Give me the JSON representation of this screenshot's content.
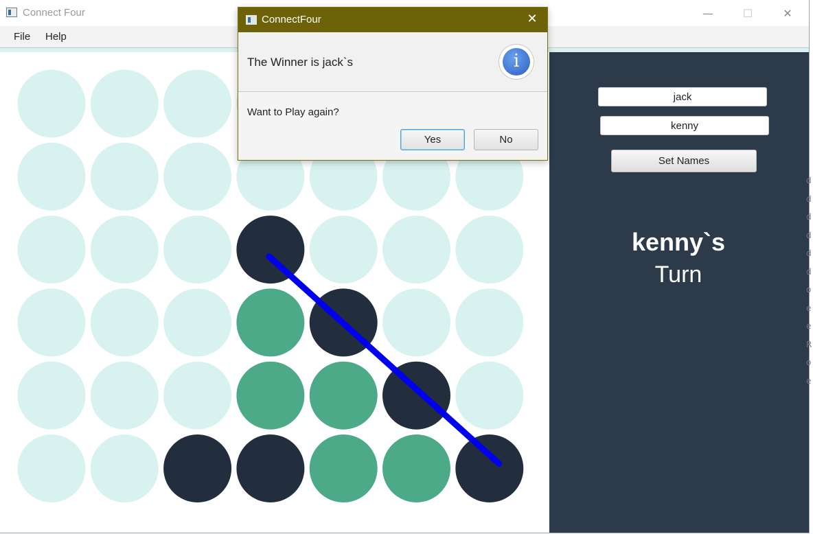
{
  "window": {
    "title": "Connect Four",
    "controls": {
      "minimize": "—",
      "maximize": "☐",
      "close": "✕"
    }
  },
  "menu": {
    "items": [
      "File",
      "Help"
    ]
  },
  "colors": {
    "empty": "#d8f3ef",
    "player_dark": "#222e3d",
    "player_green": "#4caa88",
    "win_line": "#0000ee",
    "sidebar": "#2c3a4a",
    "dialog_title": "#6e6208"
  },
  "board": {
    "columns": 7,
    "rows": 6,
    "cells": [
      [
        "empty",
        "empty",
        "empty",
        "empty",
        "empty",
        "empty",
        "empty"
      ],
      [
        "empty",
        "empty",
        "empty",
        "empty",
        "empty",
        "empty",
        "empty"
      ],
      [
        "empty",
        "empty",
        "empty",
        "dark",
        "empty",
        "empty",
        "empty"
      ],
      [
        "empty",
        "empty",
        "empty",
        "green",
        "dark",
        "empty",
        "empty"
      ],
      [
        "empty",
        "empty",
        "empty",
        "green",
        "green",
        "dark",
        "empty"
      ],
      [
        "empty",
        "empty",
        "dark",
        "dark",
        "green",
        "green",
        "dark"
      ]
    ],
    "win_line": {
      "from": [
        2,
        3
      ],
      "to": [
        5,
        6
      ]
    }
  },
  "sidebar": {
    "player1_name": "jack",
    "player2_name": "kenny",
    "set_names_label": "Set Names",
    "turn_name": "kenny`s",
    "turn_label": "Turn"
  },
  "dialog": {
    "title": "ConnectFour",
    "close_glyph": "✕",
    "header_text": "The Winner is jack`s",
    "info_glyph": "i",
    "content_text": "Want to Play again?",
    "yes_label": "Yes",
    "no_label": "No"
  }
}
